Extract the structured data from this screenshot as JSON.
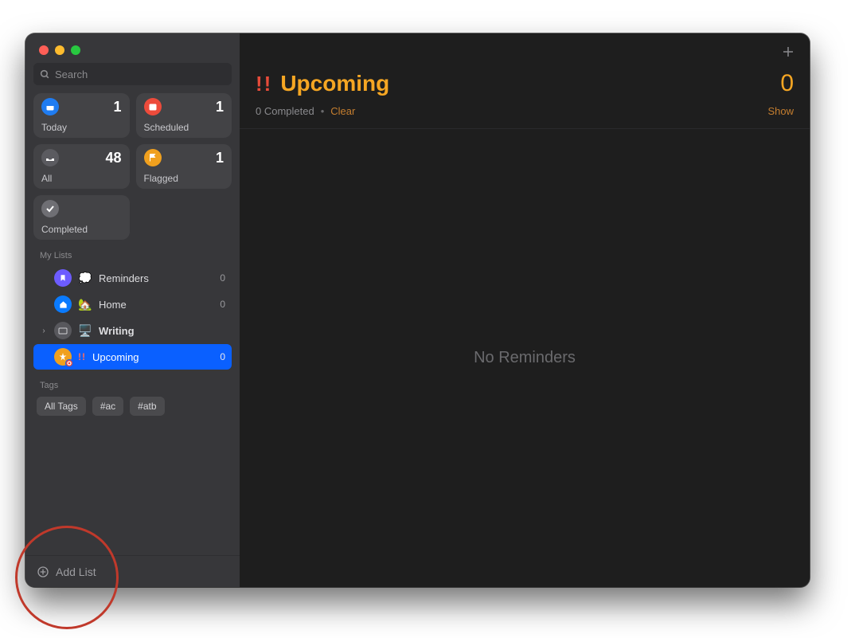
{
  "search": {
    "placeholder": "Search"
  },
  "smart": {
    "today": {
      "label": "Today",
      "count": "1"
    },
    "scheduled": {
      "label": "Scheduled",
      "count": "1"
    },
    "all": {
      "label": "All",
      "count": "48"
    },
    "flagged": {
      "label": "Flagged",
      "count": "1"
    },
    "completed": {
      "label": "Completed"
    }
  },
  "sections": {
    "my_lists": "My Lists",
    "tags": "Tags"
  },
  "lists": [
    {
      "name": "Reminders",
      "emoji": "💭",
      "count": "0",
      "color": "#6d5cff"
    },
    {
      "name": "Home",
      "emoji": "🏡",
      "count": "0",
      "color": "#0a7bff"
    },
    {
      "name": "Writing",
      "emoji": "🖥️",
      "folder": true
    },
    {
      "name": "Upcoming",
      "prefix": "!!",
      "count": "0",
      "color": "#f0a01e",
      "selected": true
    }
  ],
  "tags": [
    "All Tags",
    "#ac",
    "#atb"
  ],
  "footer": {
    "add_list": "Add List"
  },
  "main": {
    "prefix": "!!",
    "title": "Upcoming",
    "count": "0",
    "completed_text": "0 Completed",
    "clear": "Clear",
    "show": "Show",
    "empty": "No Reminders",
    "accent": "#f5a623"
  }
}
